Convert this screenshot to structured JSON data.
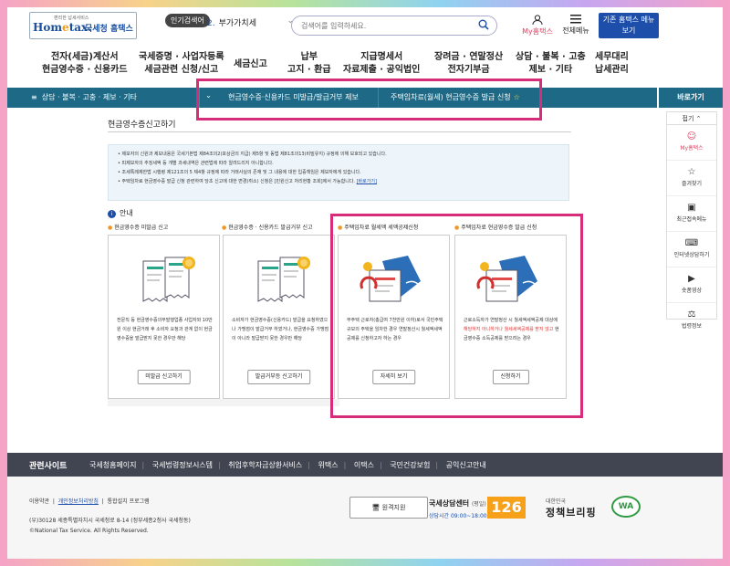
{
  "header": {
    "logo_mark": "Hometax",
    "logo_sub": "국세청 홈택스",
    "logo_small": "편리한 납세서비스",
    "popular_label": "인기검색어",
    "popular_rank": "2.",
    "popular_term": "부가가치세",
    "search_placeholder": "검색어를 입력하세요.",
    "my_hometax": "My홈택스",
    "all_menu": "전체메뉴",
    "old_hometax": "기존 홈택스 메뉴 보기"
  },
  "gnb": [
    {
      "l1": "전자(세금)계산서",
      "l2": "현금영수증 · 신용카드"
    },
    {
      "l1": "국세증명 · 사업자등록",
      "l2": "세금관련 신청/신고"
    },
    {
      "l1": "세금신고",
      "l2": ""
    },
    {
      "l1": "납부",
      "l2": "고지 · 환급"
    },
    {
      "l1": "지급명세서",
      "l2": "자료제출 · 공익법인"
    },
    {
      "l1": "장려금 · 연말정산",
      "l2": "전자기부금"
    },
    {
      "l1": "상담 · 불복 · 고충",
      "l2": "제보 · 기타"
    },
    {
      "l1": "세무대리",
      "l2": "납세관리"
    }
  ],
  "breadcrumb": {
    "home": "상담 · 불복 · 고충 · 제보 · 기타",
    "level2": "현금영수증·신용카드 미발급/발급거부 제보",
    "level3": "주택임차료(월세) 현금영수증 발급 신청"
  },
  "quick": {
    "title": "바로가기",
    "fold": "접기",
    "items": [
      "My홈택스",
      "즐겨찾기",
      "최근접속메뉴",
      "인터넷상담하기",
      "숏폼영상",
      "법령정보"
    ]
  },
  "page": {
    "title": "현금영수증신고하기",
    "notices": [
      "제보자의 신원과 제보내용은 국세기본법 제84조의2(포상금의 지급) 제5항 및 동법 제81조의13(비밀유지) 규정에 의해 보호되고 있습니다.",
      "피제보자의 추징세액 등 개별 과세내역은 관련법에 따라 알려드리지 아니합니다.",
      "조세특례제한법 시행령 제121조의 5 제4항 규정에 따라 거래사실의 존재 및 그 내용에 대한 입증책임은 제보자에게 있습니다.",
      "주택임차료 현금영수증 발급 신청 관련하여 당초 신고에 대한 변경(취소) 신청은 [민원신고 처리현황 조회]에서 가능합니다."
    ],
    "shortcut_link": "[바로가기]",
    "guide_label": "안내"
  },
  "cards": [
    {
      "label": "현금영수증 미발급 신고",
      "text": "전문직 등 현금영수증의무발행업종 사업자와 10만원 이상 현금거래 후 소비자 요청과 관계 없이 현금영수증을 발급받지 못한 경우만 해당",
      "button": "미발급 신고하기"
    },
    {
      "label": "현금영수증 · 신용카드 발급거부 신고",
      "text": "소비자가 현금영수증(신용카드) 발급을 요청하였으나 가맹점이 발급거부 하였거나, 현금영수증 가맹점이 아니라 발급받지 못한 경우만 해당",
      "button": "발급거부등 신고하기"
    },
    {
      "label": "주택임차료 월세액 세액공제신청",
      "text": "무주택 근로자(총급여 7천만원 이하)로서 국민주택규모의 주택을 임차한 경우 연말정산시 월세액세액공제를 신청하고자 하는 경우",
      "button": "자세히 보기"
    },
    {
      "label": "주택임차료 현금영수증 발급 신청",
      "text_a": "근로소득자가 연말정산 시 월세액세액공제 대상에 ",
      "text_red": "해당하지 아니하거나 월세세액공제를 받지 않고",
      "text_b": " 현금영수증 소득공제를 받으려는 경우",
      "button": "신청하기"
    }
  ],
  "footer": {
    "heading": "관련사이트",
    "links": [
      "국세청홈페이지",
      "국세법령정보시스템",
      "취업후학자금상환서비스",
      "위택스",
      "이택스",
      "국민건강보험",
      "공익신고안내"
    ],
    "terms": "이용약관",
    "privacy": "개인정보처리방침",
    "install": "통합설치 프로그램",
    "address": "(우)30128 세종특별자치시 국세청로 8-14 (정부세종2청사 국세청동)",
    "copyright": "©National Tax Service. All Rights Reserved.",
    "remote": "원격지원",
    "center": "국세상담센터",
    "center_weekday": "(평일)",
    "center_hours": "상담시간 09:00~18:00",
    "center_number": "126",
    "briefing_small": "대한민국",
    "briefing": "정책브리핑",
    "wa_mark": "WA"
  }
}
